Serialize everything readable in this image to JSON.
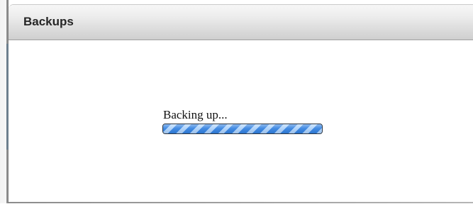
{
  "panel": {
    "title": "Backups"
  },
  "backup_status": {
    "label": "Backing up...",
    "progress": 1.0,
    "indeterminate": true,
    "bar_color": "#2f7fe0",
    "stripe_color": "#a9d0fb"
  },
  "colors": {
    "header_top": "#f7f7f7",
    "header_bottom": "#cfcfcf",
    "title_text": "#262626",
    "body_background": "#ffffff"
  }
}
